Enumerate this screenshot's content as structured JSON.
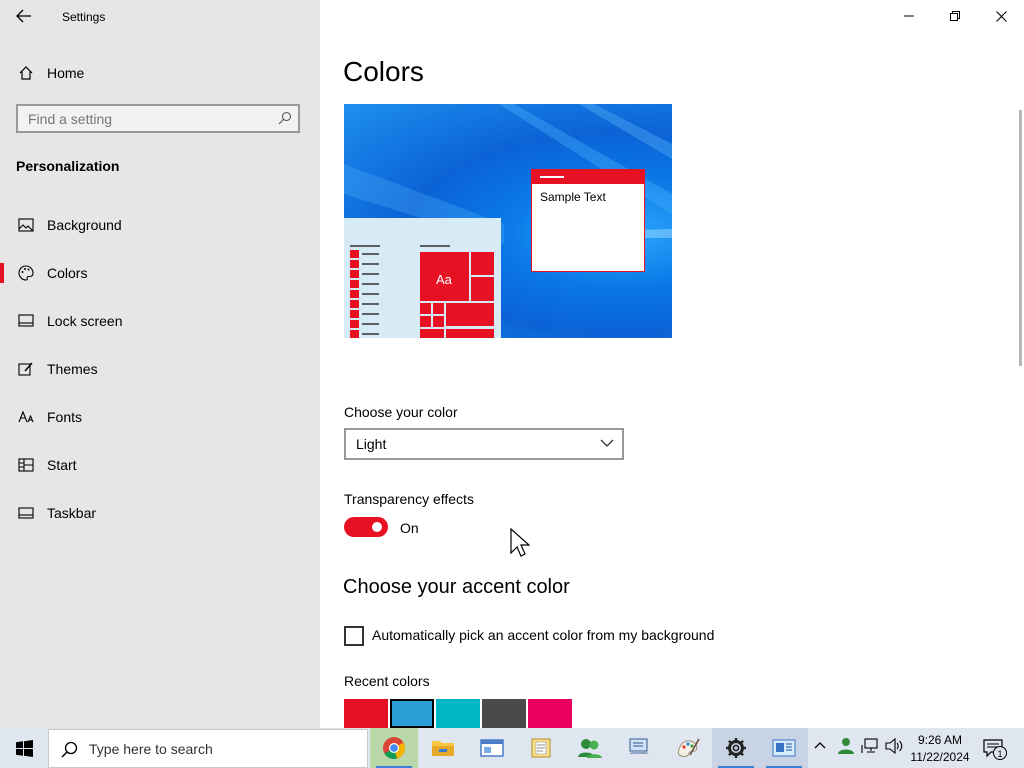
{
  "window": {
    "title": "Settings"
  },
  "sidebar": {
    "home_label": "Home",
    "search_placeholder": "Find a setting",
    "section": "Personalization",
    "items": [
      {
        "label": "Background",
        "icon": "image-icon"
      },
      {
        "label": "Colors",
        "icon": "palette-icon",
        "selected": true
      },
      {
        "label": "Lock screen",
        "icon": "lock-screen-icon"
      },
      {
        "label": "Themes",
        "icon": "brush-icon"
      },
      {
        "label": "Fonts",
        "icon": "font-icon"
      },
      {
        "label": "Start",
        "icon": "start-icon"
      },
      {
        "label": "Taskbar",
        "icon": "taskbar-icon"
      }
    ]
  },
  "main": {
    "title": "Colors",
    "preview": {
      "sample_text": "Sample Text",
      "tile_text": "Aa"
    },
    "choose_color": {
      "label": "Choose your color",
      "value": "Light"
    },
    "transparency": {
      "label": "Transparency effects",
      "state": "On",
      "on": true
    },
    "accent": {
      "heading": "Choose your accent color",
      "auto_pick_label": "Automatically pick an accent color from my background",
      "auto_pick_checked": false,
      "recent_label": "Recent colors",
      "recent_colors": [
        "#e81123",
        "#2d9fd8",
        "#00b7c3",
        "#4c4a48",
        "#ea005e"
      ]
    }
  },
  "taskbar": {
    "search_placeholder": "Type here to search",
    "time": "9:26 AM",
    "date": "11/22/2024",
    "notification_count": "1"
  },
  "colors": {
    "accent": "#e81123",
    "sidebar_bg": "#e6e6e6",
    "taskbar_bg": "#dfe6ef"
  }
}
